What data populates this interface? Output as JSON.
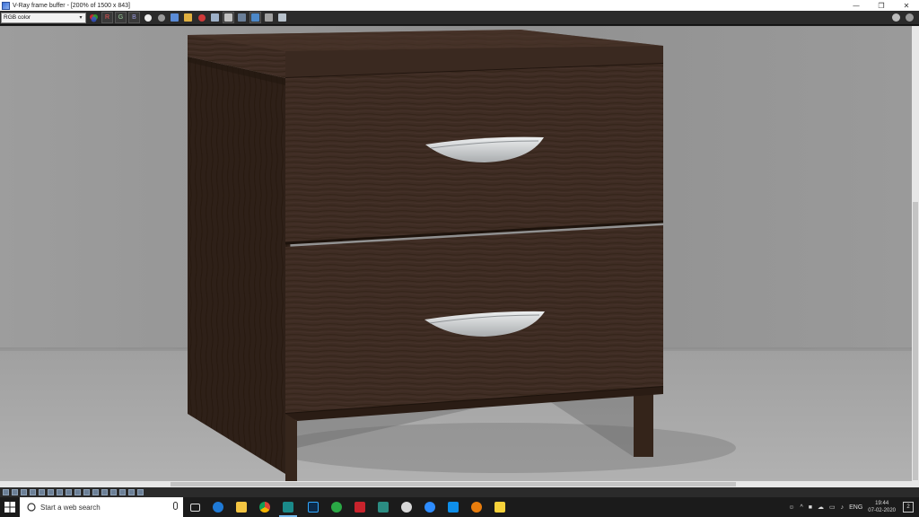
{
  "window": {
    "title": "V-Ray frame buffer - [200% of 1500 x 843]",
    "minimize_glyph": "—",
    "restore_glyph": "❐",
    "close_glyph": "✕"
  },
  "toolbar": {
    "channel_select_value": "RGB color",
    "channel_r_label": "R",
    "channel_g_label": "G",
    "channel_b_label": "B"
  },
  "scene": {
    "description_icon": "nightstand-render",
    "wood_color": "#3d2b22",
    "wood_dark": "#2a1c15",
    "handle_color": "#cfd2d4"
  },
  "taskbar": {
    "search_placeholder": "Start a web search",
    "language": "ENG",
    "time": "19:44",
    "date": "07-02-2020",
    "notification_count": "2"
  }
}
